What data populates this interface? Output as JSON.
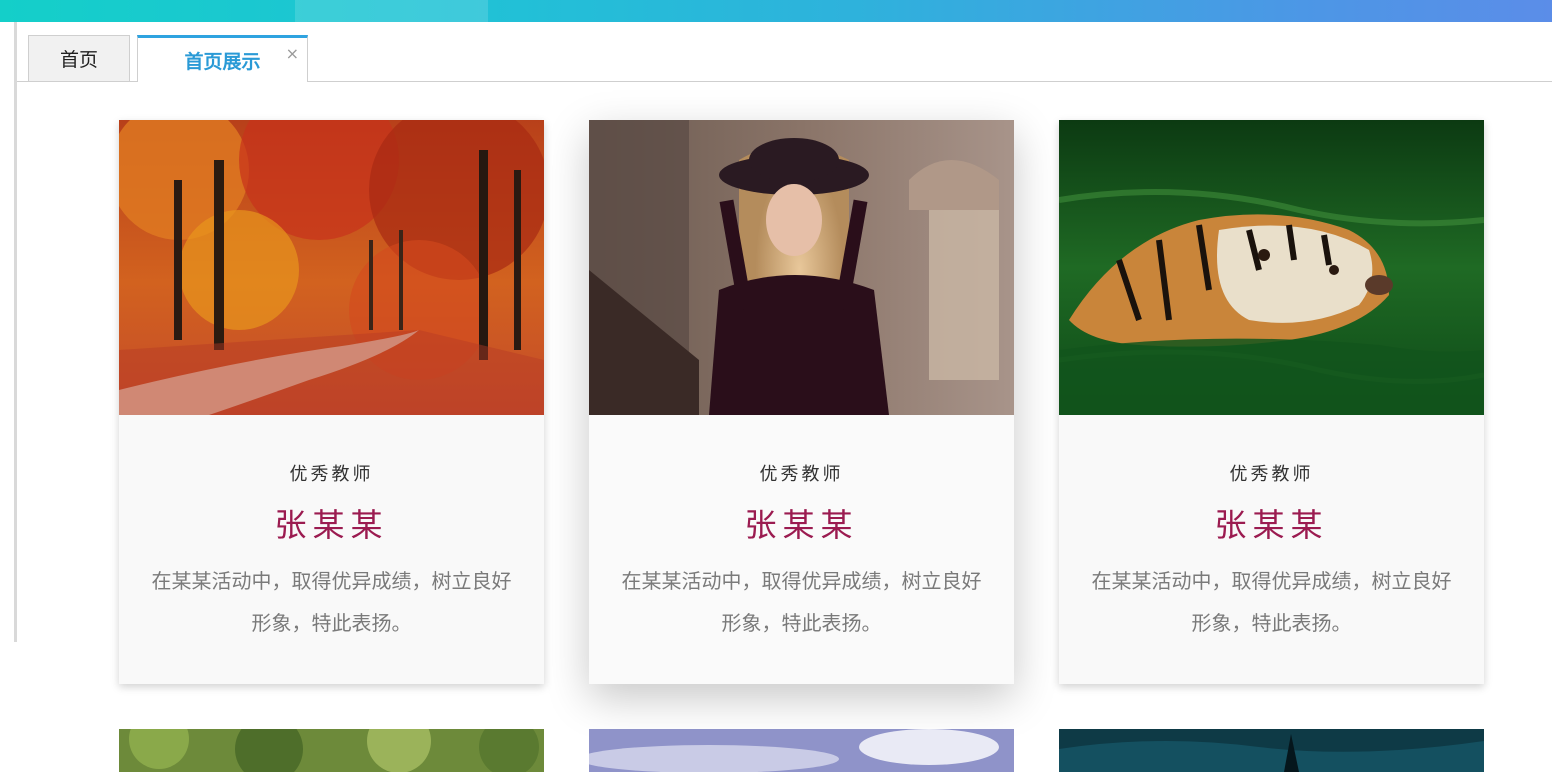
{
  "tabs": [
    {
      "label": "首页",
      "active": false
    },
    {
      "label": "首页展示",
      "active": true,
      "close": "×"
    }
  ],
  "colors": {
    "accent": "#2a9ad6",
    "name": "#9b1b50",
    "topbar_start": "#14cfc9",
    "topbar_end": "#5b8de8"
  },
  "cards": [
    {
      "image": "autumn-forest-path",
      "role": "优秀教师",
      "name": "张某某",
      "description": "在某某活动中，取得优异成绩，树立良好形象，特此表扬。"
    },
    {
      "image": "woman-in-hat",
      "role": "优秀教师",
      "name": "张某某",
      "description": "在某某活动中，取得优异成绩，树立良好形象，特此表扬。"
    },
    {
      "image": "tiger-swimming",
      "role": "优秀教师",
      "name": "张某某",
      "description": "在某某活动中，取得优异成绩，树立良好形象，特此表扬。"
    }
  ],
  "next_row_images": [
    "green-trees",
    "sky-clouds",
    "dark-sea-wave"
  ]
}
